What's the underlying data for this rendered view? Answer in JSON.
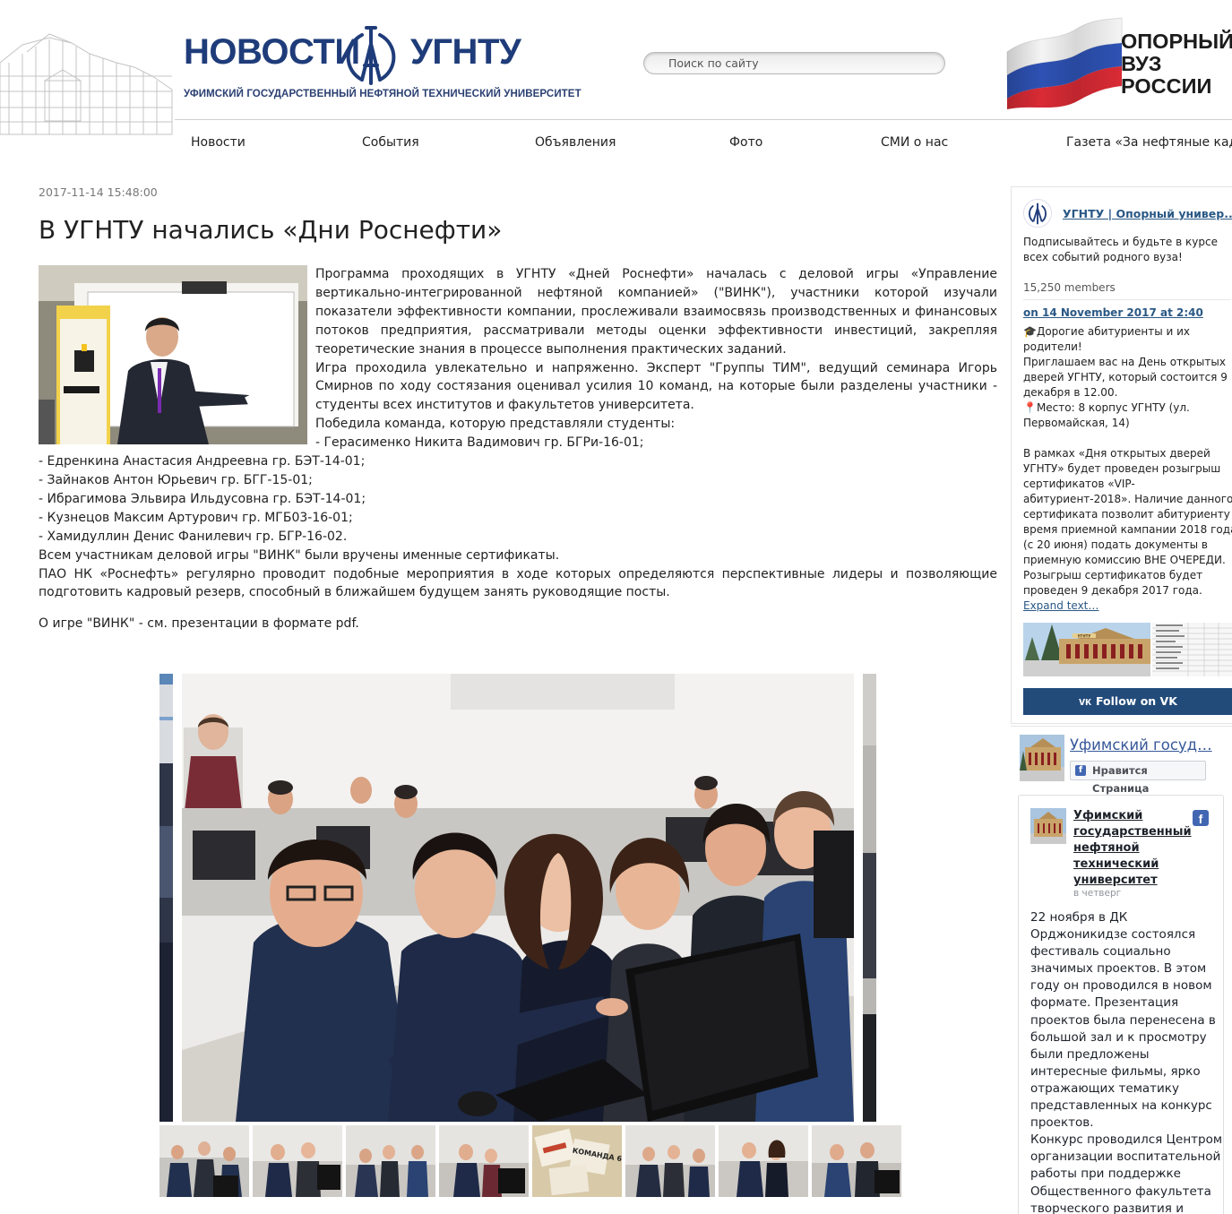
{
  "header": {
    "logo_word_1": "НОВОСТИ",
    "logo_word_2": "УГНТУ",
    "logo_subtitle": "УФИМСКИЙ ГОСУДАРСТВЕННЫЙ НЕФТЯНОЙ ТЕХНИЧЕСКИЙ УНИВЕРСИТЕТ",
    "search_placeholder": "Поиск по сайту",
    "badge_lines": [
      "ОПОРНЫЙ",
      "ВУЗ",
      "РОССИИ"
    ]
  },
  "nav": {
    "items": [
      "Новости",
      "События",
      "Объявления",
      "Фото",
      "СМИ о нас",
      "Газета «За нефтяные кадры»"
    ]
  },
  "article": {
    "date": "2017-11-14 15:48:00",
    "title": "В УГНТУ начались «Дни Роснефти»",
    "paragraphs": [
      "Программа проходящих в УГНТУ «Дней Роснефти» началась с деловой игры «Управление вертикально-интегрированной нефтяной компанией» (\"ВИНК\"), участники которой изучали показатели эффективности компании, прослеживали взаимосвязь производственных и финансовых потоков предприятия, рассматривали методы оценки эффективности инвестиций, закрепляя теоретические знания в процессе выполнения практических заданий.",
      "Игра проходила увлекательно и напряженно. Эксперт \"Группы ТИМ\", ведущий семинара Игорь Смирнов по ходу состязания оценивал усилия 10 команд, на которые были разделены участники - студенты всех институтов и факультетов университета.",
      "Победила команда, которую представляли студенты:"
    ],
    "winners": [
      "- Герасименко Никита Вадимович гр. БГРи-16-01;",
      "- Едренкина Анастасия Андреевна гр. БЭТ-14-01;",
      "- Зайнаков Антон Юрьевич гр. БГГ-15-01;",
      "- Ибрагимова Эльвира Ильдусовна гр. БЭТ-14-01;",
      "- Кузнецов Максим Артурович гр. МГБ03-16-01;",
      "- Хамидуллин Денис Фанилевич гр. БГР-16-02."
    ],
    "after": [
      "Всем участникам деловой игры \"ВИНК\" были вручены именные сертификаты.",
      "ПАО НК «Роснефть» регулярно проводит подобные мероприятия в ходе которых определяются перспективные лидеры и позволяющие подготовить кадровый резерв, способный в ближайшем будущем занять руководящие посты."
    ],
    "note": "О игре \"ВИНК\" - см. презентации в формате pdf."
  },
  "gallery": {
    "thumbs": [
      {
        "index": 1,
        "label": ""
      },
      {
        "index": 2,
        "label": ""
      },
      {
        "index": 3,
        "label": ""
      },
      {
        "index": 4,
        "label": ""
      },
      {
        "index": 5,
        "label": "КОМАНДА 6"
      },
      {
        "index": 6,
        "label": ""
      },
      {
        "index": 7,
        "label": ""
      },
      {
        "index": 8,
        "label": ""
      }
    ]
  },
  "vk_widget": {
    "group_name": "УГНТУ | Опорный универ...",
    "description": "Подписывайтесь и будьте в курсе всех событий родного вуза!",
    "members": "15,250 members",
    "post_date": "on 14 November 2017 at 2:40",
    "post_lines": [
      "🎓Дорогие абитуриенты и их",
      "родители!",
      "Приглашаем вас на День открытых",
      "дверей УГНТУ, который состоится 9",
      "декабря в 12.00.",
      "📍Место: 8 корпус УГНТУ (ул.",
      "Первомайская, 14)",
      "",
      "В рамках «Дня открытых дверей",
      "УГНТУ» будет проведен розыгрыш",
      "сертификатов «VIP-",
      "абитуриент-2018». Наличие данного",
      "сертификата позволит абитуриенту во",
      "время приемной кампании 2018 года",
      "(с 20 июня) подать документы в",
      "приемную комиссию ВНЕ ОЧЕРЕДИ.",
      "Розыгрыш сертификатов будет",
      "проведен 9 декабря 2017 года."
    ],
    "expand": "Expand text…",
    "photo_sign": "УГНТУ",
    "follow": "Follow on VK"
  },
  "fb_page": {
    "title": "Уфимский госуд…",
    "like": "Нравится Страница"
  },
  "fb_feed": {
    "name": "Уфимский государственный нефтяной технический университет",
    "when": "в четверг",
    "text_lines": [
      "22 ноября в ДК",
      "Орджоникидзе состоялся",
      "фестиваль социально",
      "значимых проектов. В этом",
      "году он проводился в новом",
      "формате. Презентация",
      "проектов была перенесена в",
      "большой зал и к просмотру",
      "были предложены",
      "интересные фильмы, ярко",
      "отражающих тематику",
      "представленных на конкурс",
      "проектов.",
      "Конкурс проводился Центром",
      "организации воспитательной",
      "работы при поддержке",
      "Общественного факультета",
      "творческого развития и"
    ]
  },
  "colors": {
    "brand_blue": "#1f3c7a",
    "vk_button": "#224b7a",
    "vk_link": "#2a5885",
    "fb_blue": "#4267b2"
  }
}
